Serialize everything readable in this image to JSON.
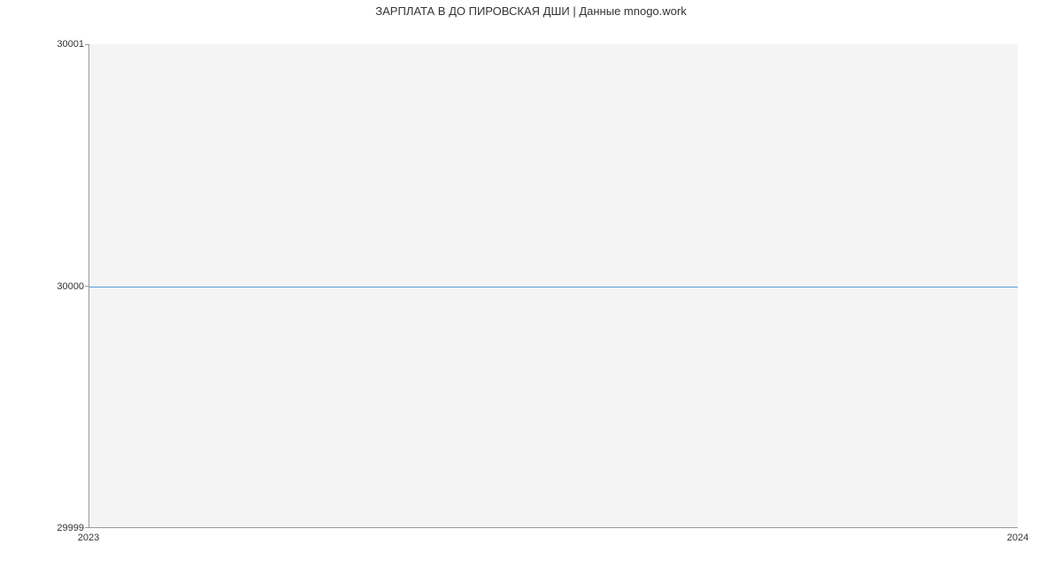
{
  "chart_data": {
    "type": "line",
    "title": "ЗАРПЛАТА В ДО ПИРОВСКАЯ ДШИ | Данные mnogo.work",
    "xlabel": "",
    "ylabel": "",
    "x": [
      2023,
      2024
    ],
    "values": [
      30000,
      30000
    ],
    "xlim": [
      2023,
      2024
    ],
    "ylim": [
      29999,
      30001
    ],
    "x_ticks": [
      "2023",
      "2024"
    ],
    "y_ticks": [
      "29999",
      "30000",
      "30001"
    ]
  }
}
